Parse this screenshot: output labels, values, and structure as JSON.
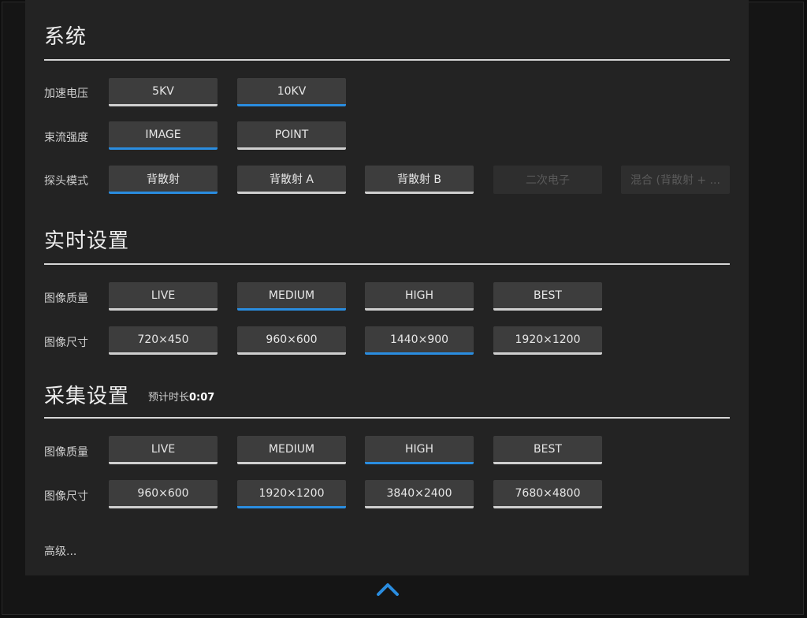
{
  "system": {
    "title": "系统",
    "voltage": {
      "label": "加速电压",
      "options": [
        "5KV",
        "10KV"
      ]
    },
    "beam": {
      "label": "束流强度",
      "options": [
        "IMAGE",
        "POINT"
      ]
    },
    "detector": {
      "label": "探头模式",
      "options": [
        "背散射",
        "背散射 A",
        "背散射 B",
        "二次电子",
        "混合 (背散射 + ..."
      ]
    }
  },
  "realtime": {
    "title": "实时设置",
    "quality": {
      "label": "图像质量",
      "options": [
        "LIVE",
        "MEDIUM",
        "HIGH",
        "BEST"
      ]
    },
    "size": {
      "label": "图像尺寸",
      "options": [
        "720×450",
        "960×600",
        "1440×900",
        "1920×1200"
      ]
    }
  },
  "acquisition": {
    "title": "采集设置",
    "estimate_label": "预计时长",
    "estimate_value": "0:07",
    "quality": {
      "label": "图像质量",
      "options": [
        "LIVE",
        "MEDIUM",
        "HIGH",
        "BEST"
      ]
    },
    "size": {
      "label": "图像尺寸",
      "options": [
        "960×600",
        "1920×1200",
        "3840×2400",
        "7680×4800"
      ]
    }
  },
  "advanced_label": "高级...",
  "colors": {
    "accent": "#2a8de0",
    "panel": "#232323",
    "button": "#3d3d3d"
  },
  "icons": {
    "collapse": "chevron-up-icon"
  }
}
